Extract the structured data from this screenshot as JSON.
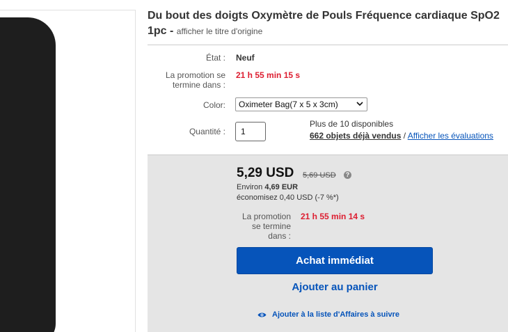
{
  "product": {
    "title": "Du bout des doigts Oxymètre de Pouls Fréquence cardiaque SpO2 1pc -",
    "show_original_title": "afficher le titre d'origine"
  },
  "details": {
    "condition_label": "État :",
    "condition_value": "Neuf",
    "promo_label": "La promotion se termine dans :",
    "promo_countdown": "21 h 55 min 15 s",
    "color_label": "Color:",
    "color_selected": "Oximeter Bag(7 x 5 x 3cm)",
    "quantity_label": "Quantité :",
    "quantity_value": "1",
    "availability": "Plus de 10 disponibles",
    "sold_count": "662 objets déjà vendus",
    "separator": "/",
    "reviews_link": "Afficher les évaluations"
  },
  "buybox": {
    "price": "5,29 USD",
    "original_price": "5,69 USD",
    "help_glyph": "?",
    "approx_prefix": "Environ",
    "approx_value": "4,69 EUR",
    "savings": "économisez 0,40 USD (-7 %*)",
    "promo_label": "La promotion se termine dans :",
    "promo_countdown": "21 h 55 min 14 s",
    "buy_now": "Achat immédiat",
    "add_to_cart": "Ajouter au panier",
    "watchlist": "Ajouter à la liste d'Affaires à suivre"
  },
  "icons": {
    "help": "help-icon",
    "dropdown": "chevron-down-icon",
    "watch": "eye-icon"
  },
  "colors": {
    "link_blue": "#0654ba",
    "countdown_red": "#dd1e31",
    "buybox_bg": "#e5e5e5"
  }
}
